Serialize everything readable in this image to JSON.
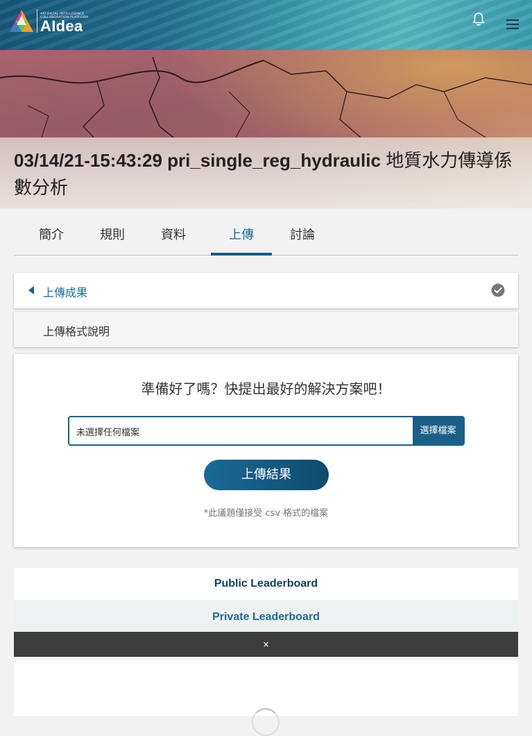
{
  "header": {
    "logo_tagline": "Artificial Intelligence Collaboration Platform",
    "logo_text": "AIdea",
    "icons": {
      "notifications": "bell-icon",
      "menu": "hamburger-menu-icon"
    }
  },
  "hero": {
    "title_code": "03/14/21-15:43:29 pri_single_reg_hydraulic",
    "title_zh": "地質水力傳導係數分析"
  },
  "tabs": [
    {
      "label": "簡介",
      "active": false
    },
    {
      "label": "規則",
      "active": false
    },
    {
      "label": "資料",
      "active": false
    },
    {
      "label": "上傳",
      "active": true
    },
    {
      "label": "討論",
      "active": false
    }
  ],
  "accordion": {
    "upload_results": {
      "label": "上傳成果",
      "icon": "caret-left-icon",
      "status_icon": "check-circle-icon"
    },
    "format_help": {
      "label": "上傳格式說明"
    }
  },
  "upload": {
    "prompt": "準備好了嗎？快提出最好的解決方案吧！",
    "file_value": "未選擇任何檔案",
    "choose_file_label": "選擇檔案",
    "submit_label": "上傳結果",
    "note": "*此議題僅接受 csv 格式的檔案"
  },
  "leaderboards": {
    "public_label": "Public Leaderboard",
    "private_label": "Private Leaderboard",
    "close_glyph": "×"
  },
  "colors": {
    "accent": "#1b6a96",
    "accent_dark": "#0f4a6c",
    "leaderboard_text": "#10405e",
    "dark_bar": "#3c3c3c"
  }
}
